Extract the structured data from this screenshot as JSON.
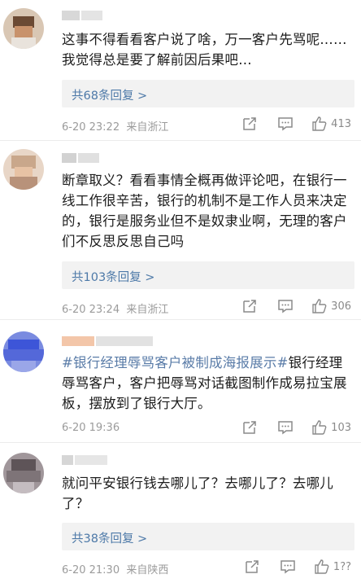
{
  "comments": [
    {
      "text": "这事不得看看客户说了啥，万一客户先骂呢……我觉得总是要了解前因后果吧…",
      "reply_label": "共68条回复 >",
      "time": "6-20 23:22",
      "location": "来自浙江",
      "likes": "413"
    },
    {
      "text": "断章取义？看看事情全概再做评论吧，在银行一线工作很辛苦，银行的机制不是工作人员来决定的，银行是服务业但不是奴隶业啊，无理的客户们不反思反思自己吗",
      "reply_label": "共103条回复 >",
      "time": "6-20 23:24",
      "location": "来自浙江",
      "likes": "306"
    },
    {
      "text_tag": "#银行经理辱骂客户被制成海报展示#",
      "text": "银行经理辱骂客户，客户把辱骂对话截图制作成易拉宝展板，摆放到了银行大厅。",
      "time": "6-20 19:36",
      "location": "",
      "likes": "103"
    },
    {
      "text": "就问平安银行钱去哪儿了？去哪儿了？去哪儿了？",
      "reply_label": "共38条回复 >",
      "time": "6-20 21:30",
      "location": "来自陕西",
      "likes": "1??"
    }
  ],
  "colors": {
    "link": "#4d79a8",
    "meta": "#9b9b9b",
    "reply_bg": "#f2f2f2"
  },
  "icons": [
    "share-icon",
    "comment-icon",
    "like-icon"
  ]
}
